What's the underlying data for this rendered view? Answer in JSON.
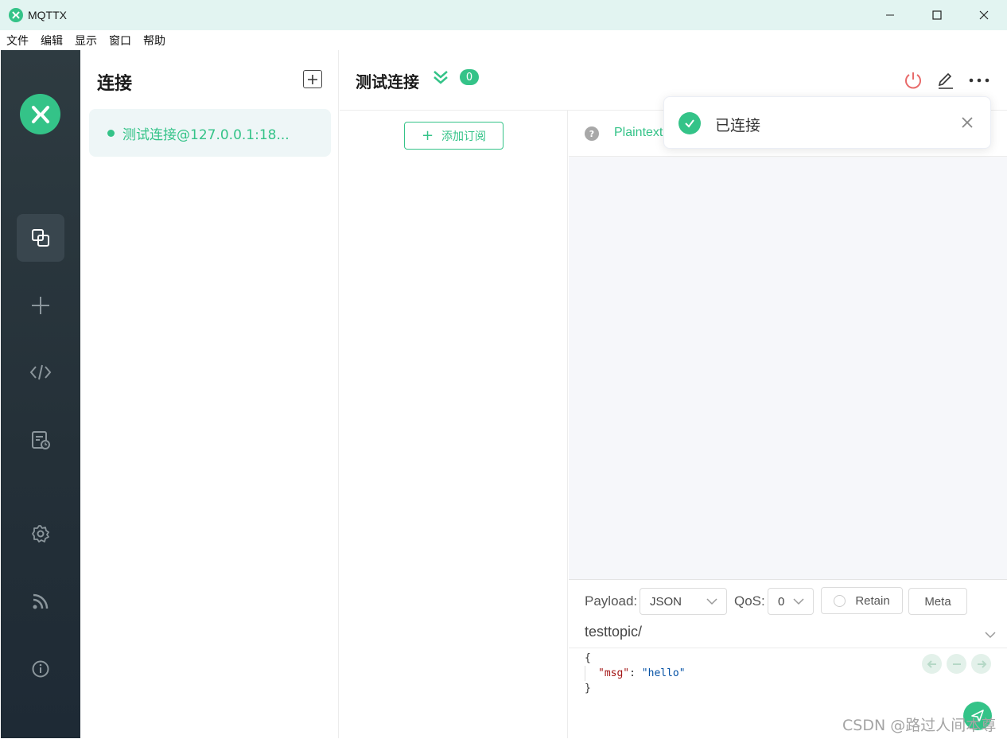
{
  "window": {
    "title": "MQTTX"
  },
  "menu": [
    "文件",
    "编辑",
    "显示",
    "窗口",
    "帮助"
  ],
  "sidebar": {
    "items": [
      {
        "name": "connections",
        "icon": "connections-icon",
        "active": true
      },
      {
        "name": "new-connection",
        "icon": "plus-icon",
        "active": false
      },
      {
        "name": "script",
        "icon": "code-icon",
        "active": false
      },
      {
        "name": "log",
        "icon": "log-icon",
        "active": false
      },
      {
        "name": "settings",
        "icon": "gear-icon",
        "active": false
      },
      {
        "name": "subscription",
        "icon": "rss-icon",
        "active": false
      },
      {
        "name": "about",
        "icon": "info-icon",
        "active": false
      }
    ]
  },
  "connections": {
    "title": "连接",
    "items": [
      {
        "label": "测试连接@127.0.0.1:18...",
        "status": "connected"
      }
    ]
  },
  "main": {
    "title": "测试连接",
    "message_count": "0",
    "add_subscription": "添加订阅",
    "payload_format_tab": "Plaintext"
  },
  "publish": {
    "payload_label": "Payload:",
    "payload_type": "JSON",
    "qos_label": "QoS:",
    "qos_value": "0",
    "retain_label": "Retain",
    "meta_label": "Meta",
    "topic": "testtopic/",
    "payload_lines": [
      "{",
      "\"msg\": \"hello\"",
      "}"
    ],
    "payload_key": "\"msg\"",
    "payload_colon": ": ",
    "payload_value": "\"hello\""
  },
  "notification": {
    "text": "已连接"
  },
  "watermark": "CSDN @路过人间本尊",
  "colors": {
    "accent": "#34c388",
    "sidebar_bg": "#2e3b41",
    "danger": "#e86b6b"
  }
}
